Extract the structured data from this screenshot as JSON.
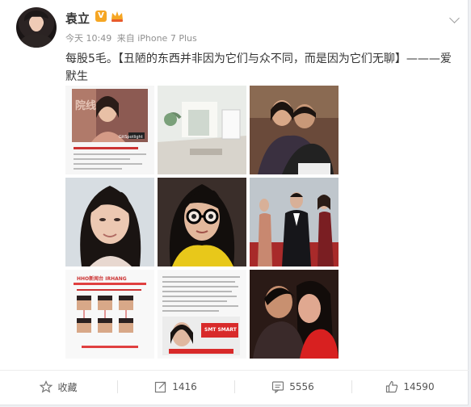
{
  "post": {
    "author": "袁立",
    "verified_badge": "V",
    "time": "今天 10:49",
    "source": "来自 iPhone 7 Plus",
    "text": "每股5毛。【丑陋的东西并非因为它们与众不同，而是因为它们无聊】———爱默生"
  },
  "images": [
    {
      "icon": "news-screenshot-woman-photo",
      "caption": "院线",
      "watermark": "GitSpotlight"
    },
    {
      "icon": "interior-room-photo"
    },
    {
      "icon": "couple-hug-photo"
    },
    {
      "icon": "woman-portrait-photo"
    },
    {
      "icon": "woman-glasses-photo"
    },
    {
      "icon": "red-carpet-photo"
    },
    {
      "icon": "article-screenshot-faces",
      "header": "HHO新闻台 IRHANG"
    },
    {
      "icon": "article-screenshot-text",
      "banner": "SMT SMART"
    },
    {
      "icon": "couple-red-photo"
    }
  ],
  "actions": {
    "favorite": "收藏",
    "repost_count": "1416",
    "comment_count": "5556",
    "like_count": "14590"
  },
  "colors": {
    "accent_orange": "#f5a623",
    "text": "#333333",
    "meta": "#909090"
  }
}
